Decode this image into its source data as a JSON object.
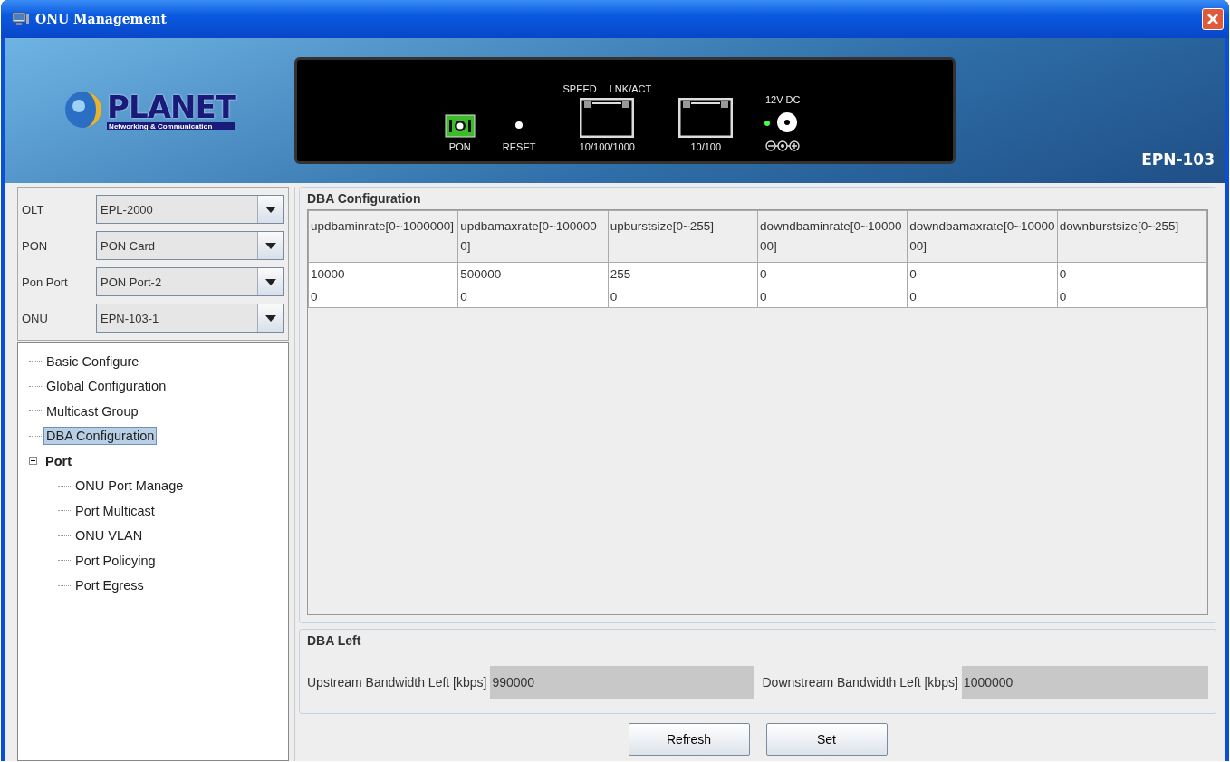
{
  "window": {
    "title": "ONU Management"
  },
  "banner": {
    "logo": "PLANET",
    "tagline": "Networking & Communication",
    "model": "EPN-103",
    "device_labels": [
      {
        "kind": "pon",
        "label": "PON"
      },
      {
        "kind": "reset",
        "label": "RESET"
      },
      {
        "kind": "rj45",
        "top": "SPEED",
        "top2": "LNK/ACT",
        "label": "10/100/1000"
      },
      {
        "kind": "rj45",
        "label": "10/100"
      },
      {
        "kind": "power",
        "top": "12V DC"
      }
    ]
  },
  "selectors": [
    {
      "label": "OLT",
      "value": "EPL-2000"
    },
    {
      "label": "PON",
      "value": "PON Card"
    },
    {
      "label": "Pon Port",
      "value": "PON Port-2"
    },
    {
      "label": "ONU",
      "value": "EPN-103-1"
    }
  ],
  "tree": [
    {
      "label": "Basic Configure",
      "selected": false
    },
    {
      "label": "Global Configuration",
      "selected": false
    },
    {
      "label": "Multicast Group",
      "selected": false
    },
    {
      "label": "DBA Configuration",
      "selected": true
    },
    {
      "label": "Port",
      "selected": false,
      "expanded": true,
      "children": [
        {
          "label": "ONU Port Manage",
          "selected": false
        },
        {
          "label": "Port Multicast",
          "selected": false
        },
        {
          "label": "ONU VLAN",
          "selected": false
        },
        {
          "label": "Port Policying",
          "selected": false
        },
        {
          "label": "Port Egress",
          "selected": false
        }
      ]
    }
  ],
  "dba": {
    "title": "DBA Configuration",
    "columns": [
      "updbaminrate[0~1000000]",
      "updbamaxrate[0~1000000]",
      "upburstsize[0~255]",
      "downdbaminrate[0~1000000]",
      "downdbamaxrate[0~1000000]",
      "downburstsize[0~255]"
    ],
    "rows": [
      [
        "10000",
        "500000",
        "255",
        "0",
        "0",
        "0"
      ],
      [
        "0",
        "0",
        "0",
        "0",
        "0",
        "0"
      ]
    ]
  },
  "dba_left": {
    "title": "DBA Left",
    "fields": [
      {
        "label": "Upstream Bandwidth Left [kbps]",
        "value": "990000"
      },
      {
        "label": "Downstream Bandwidth Left [kbps]",
        "value": "1000000"
      }
    ]
  },
  "buttons": [
    "Refresh",
    "Set"
  ]
}
